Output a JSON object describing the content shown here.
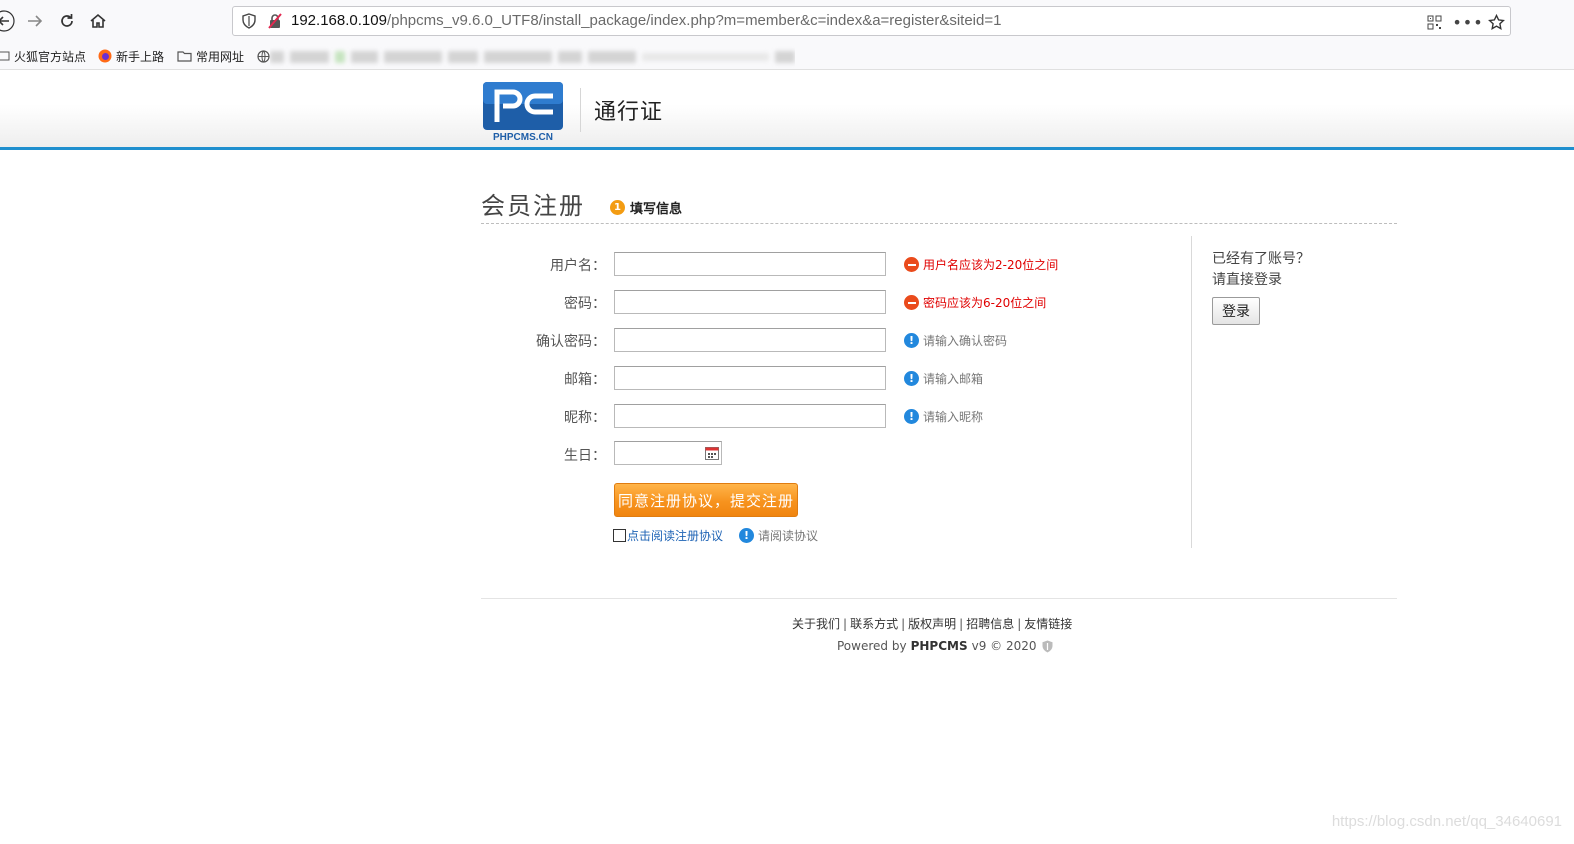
{
  "browser": {
    "url_host": "192.168.0.109",
    "url_path": "/phpcms_v9.6.0_UTF8/install_package/index.php?m=member&c=index&a=register&siteid=1",
    "bookmarks": [
      "火狐官方站点",
      "新手上路",
      "常用网址"
    ]
  },
  "header": {
    "logo_text": "PHPCMS.CN",
    "title": "通行证"
  },
  "main": {
    "title": "会员注册",
    "step_number": "1",
    "step_label": "填写信息",
    "fields": [
      {
        "label": "用户名：",
        "value": "",
        "tip": "用户名应该为2-20位之间",
        "tip_type": "error"
      },
      {
        "label": "密码：",
        "value": "",
        "tip": "密码应该为6-20位之间",
        "tip_type": "error"
      },
      {
        "label": "确认密码：",
        "value": "",
        "tip": "请输入确认密码",
        "tip_type": "info"
      },
      {
        "label": "邮箱：",
        "value": "",
        "tip": "请输入邮箱",
        "tip_type": "info"
      },
      {
        "label": "昵称：",
        "value": "",
        "tip": "请输入昵称",
        "tip_type": "info"
      }
    ],
    "birthday_label": "生日：",
    "birthday_value": "",
    "submit_label": "同意注册协议，提交注册",
    "agree_link": "点击阅读注册协议",
    "agree_tip": "请阅读协议"
  },
  "sidebar": {
    "line1": "已经有了账号？",
    "line2": "请直接登录",
    "login_label": "登录"
  },
  "footer": {
    "links": [
      "关于我们",
      "联系方式",
      "版权声明",
      "招聘信息",
      "友情链接"
    ],
    "powered_prefix": "Powered by",
    "powered_brand": "PHPCMS",
    "powered_suffix": "v9 © 2020"
  },
  "watermark": "https://blog.csdn.net/qq_34640691",
  "colors": {
    "accent_blue": "#1f8fce",
    "error_red": "#e00000",
    "button_orange": "#f7931e",
    "link_blue": "#1e63b5"
  }
}
